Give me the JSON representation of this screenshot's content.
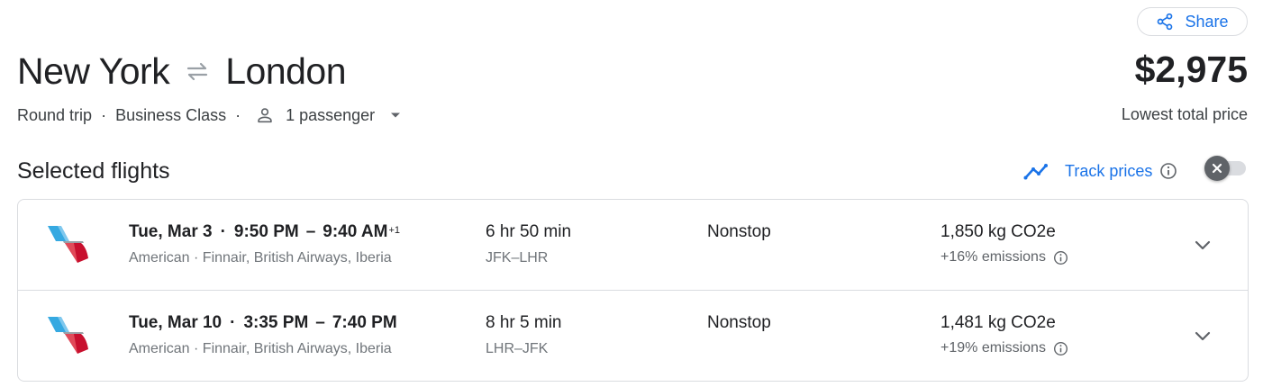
{
  "header": {
    "share_label": "Share",
    "origin": "New York",
    "destination": "London",
    "trip_type": "Round trip",
    "cabin_class": "Business Class",
    "passengers": "1 passenger",
    "price": "$2,975",
    "price_label": "Lowest total price"
  },
  "selected": {
    "title": "Selected flights",
    "track_label": "Track prices",
    "track_enabled": false
  },
  "flights": [
    {
      "date": "Tue, Mar 3",
      "depart": "9:50 PM",
      "arrive": "9:40 AM",
      "day_offset": "+1",
      "airlines": "American · Finnair, British Airways, Iberia",
      "duration": "6 hr 50 min",
      "airports": "JFK–LHR",
      "stops": "Nonstop",
      "emissions": "1,850 kg CO2e",
      "emission_diff": "+16% emissions"
    },
    {
      "date": "Tue, Mar 10",
      "depart": "3:35 PM",
      "arrive": "7:40 PM",
      "day_offset": "",
      "airlines": "American · Finnair, British Airways, Iberia",
      "duration": "8 hr 5 min",
      "airports": "LHR–JFK",
      "stops": "Nonstop",
      "emissions": "1,481 kg CO2e",
      "emission_diff": "+19% emissions"
    }
  ],
  "colors": {
    "accent": "#1a73e8",
    "text_primary": "#202124",
    "text_secondary": "#70757a",
    "border": "#dadce0",
    "airline_red": "#c8102e",
    "airline_blue": "#36a9e1"
  },
  "icons": [
    "share-icon",
    "swap-icon",
    "person-icon",
    "caret-down-icon",
    "trend-icon",
    "info-icon",
    "close-icon",
    "airline-logo",
    "chevron-down-icon"
  ]
}
